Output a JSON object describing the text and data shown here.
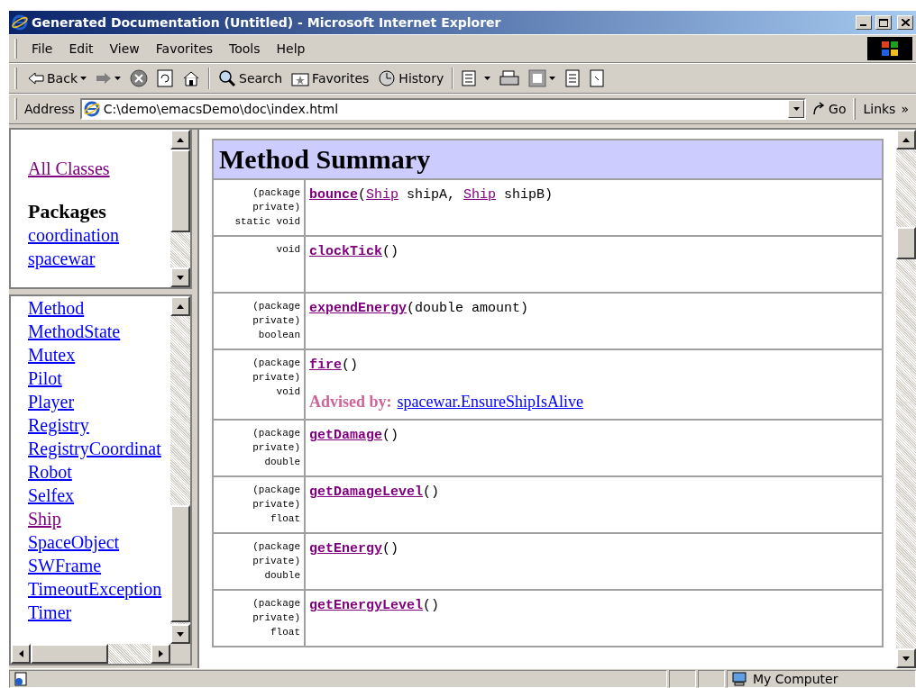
{
  "window": {
    "title": "Generated Documentation (Untitled) - Microsoft Internet Explorer"
  },
  "menu": [
    "File",
    "Edit",
    "View",
    "Favorites",
    "Tools",
    "Help"
  ],
  "toolbar": [
    {
      "kind": "button",
      "label": "Back",
      "dropdown": true
    },
    {
      "kind": "button",
      "dropdown": true,
      "disabled": true
    },
    {
      "kind": "button"
    },
    {
      "kind": "button"
    },
    {
      "kind": "button"
    },
    {
      "kind": "separator"
    },
    {
      "kind": "button",
      "label": "Search"
    },
    {
      "kind": "button",
      "label": "Favorites"
    },
    {
      "kind": "button",
      "label": "History"
    },
    {
      "kind": "separator"
    },
    {
      "kind": "button",
      "dropdown": true
    },
    {
      "kind": "button"
    },
    {
      "kind": "button",
      "dropdown": true
    },
    {
      "kind": "button"
    },
    {
      "kind": "button"
    }
  ],
  "address": {
    "label": "Address",
    "value": "C:\\demo\\emacsDemo\\doc\\index.html",
    "go": "Go",
    "links": "Links",
    "more": "»"
  },
  "packages_frame": {
    "all_classes": {
      "text": "All Classes",
      "visited": true
    },
    "heading": "Packages",
    "packages": [
      {
        "text": "coordination",
        "visited": false
      },
      {
        "text": "spacewar",
        "visited": false
      }
    ]
  },
  "classes_frame": {
    "classes": [
      {
        "text": "Method",
        "visited": false
      },
      {
        "text": "MethodState",
        "visited": false
      },
      {
        "text": "Mutex",
        "visited": false
      },
      {
        "text": "Pilot",
        "visited": false
      },
      {
        "text": "Player",
        "visited": false
      },
      {
        "text": "Registry",
        "visited": false
      },
      {
        "text": "RegistryCoordinat",
        "visited": false
      },
      {
        "text": "Robot",
        "visited": false
      },
      {
        "text": "Selfex",
        "visited": false
      },
      {
        "text": "Ship",
        "visited": true
      },
      {
        "text": "SpaceObject",
        "visited": false
      },
      {
        "text": "SWFrame",
        "visited": false
      },
      {
        "text": "TimeoutException",
        "visited": false
      },
      {
        "text": "Timer",
        "visited": false
      }
    ]
  },
  "method_summary": {
    "heading": "Method Summary",
    "rows": [
      {
        "modifier": [
          "(package",
          "private)",
          "static void"
        ],
        "name": "bounce",
        "params": [
          {
            "text": "(",
            "link": false
          },
          {
            "text": "Ship",
            "link": true
          },
          {
            "text": " shipA, ",
            "link": false
          },
          {
            "text": "Ship",
            "link": true
          },
          {
            "text": " shipB)",
            "link": false
          }
        ]
      },
      {
        "modifier": [
          "void"
        ],
        "name": "clockTick",
        "params": [
          {
            "text": "()",
            "link": false
          }
        ]
      },
      {
        "modifier": [
          "(package",
          "private)",
          "boolean"
        ],
        "name": "expendEnergy",
        "params": [
          {
            "text": "(double amount)",
            "link": false
          }
        ]
      },
      {
        "modifier": [
          "(package",
          "private)",
          "void"
        ],
        "name": "fire",
        "params": [
          {
            "text": "()",
            "link": false
          }
        ],
        "advised": {
          "label": "Advised by:",
          "link": "spacewar.EnsureShipIsAlive"
        }
      },
      {
        "modifier": [
          "(package",
          "private)",
          "double"
        ],
        "name": "getDamage",
        "params": [
          {
            "text": "()",
            "link": false
          }
        ]
      },
      {
        "modifier": [
          "(package",
          "private)",
          "float"
        ],
        "name": "getDamageLevel",
        "params": [
          {
            "text": "()",
            "link": false
          }
        ]
      },
      {
        "modifier": [
          "(package",
          "private)",
          "double"
        ],
        "name": "getEnergy",
        "params": [
          {
            "text": "()",
            "link": false
          }
        ]
      },
      {
        "modifier": [
          "(package",
          "private)",
          "float"
        ],
        "name": "getEnergyLevel",
        "params": [
          {
            "text": "()",
            "link": false
          }
        ]
      }
    ]
  },
  "status_bar": {
    "zone": "My Computer"
  }
}
